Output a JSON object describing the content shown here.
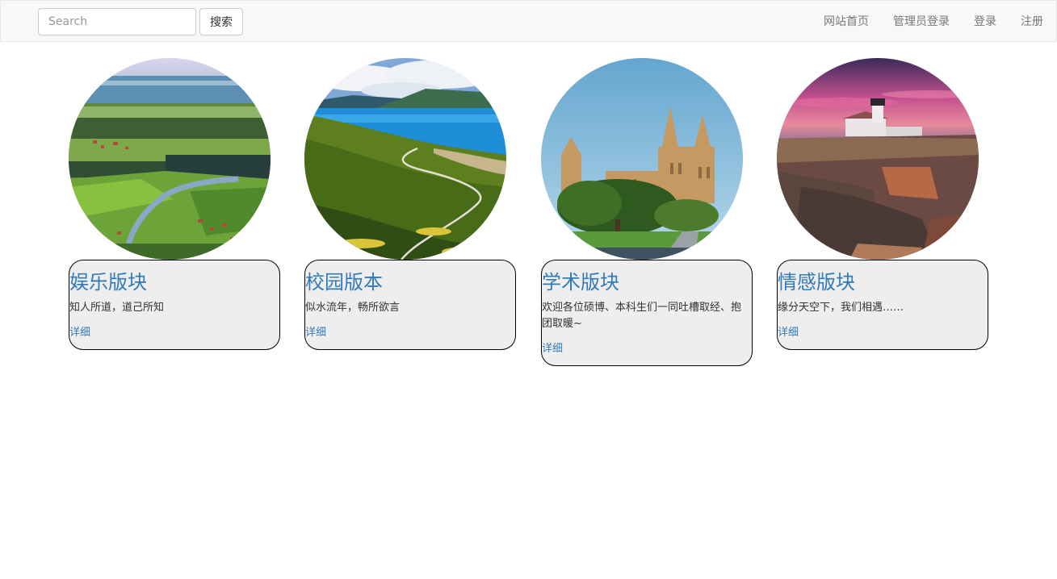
{
  "search": {
    "placeholder": "Search",
    "button_label": "搜索"
  },
  "nav": {
    "items": [
      "网站首页",
      "管理员登录",
      "登录",
      "注册"
    ]
  },
  "cards": [
    {
      "title": "娱乐版块",
      "description": "知人所道，道己所知",
      "link": "详细",
      "image": "countryside-landscape"
    },
    {
      "title": "校园版本",
      "description": "似水流年，畅所欲言",
      "link": "详细",
      "image": "mountain-lake-landscape"
    },
    {
      "title": "学术版块",
      "description": "欢迎各位硕博、本科生们一同吐槽取经、抱团取暖~",
      "link": "详细",
      "image": "cathedral-building"
    },
    {
      "title": "情感版块",
      "description": "缘分天空下，我们相遇……",
      "link": "详细",
      "image": "lighthouse-sunset"
    }
  ],
  "colors": {
    "link": "#337ab7",
    "navbar_bg": "#f8f8f8",
    "caption_bg": "#eeeeee"
  }
}
